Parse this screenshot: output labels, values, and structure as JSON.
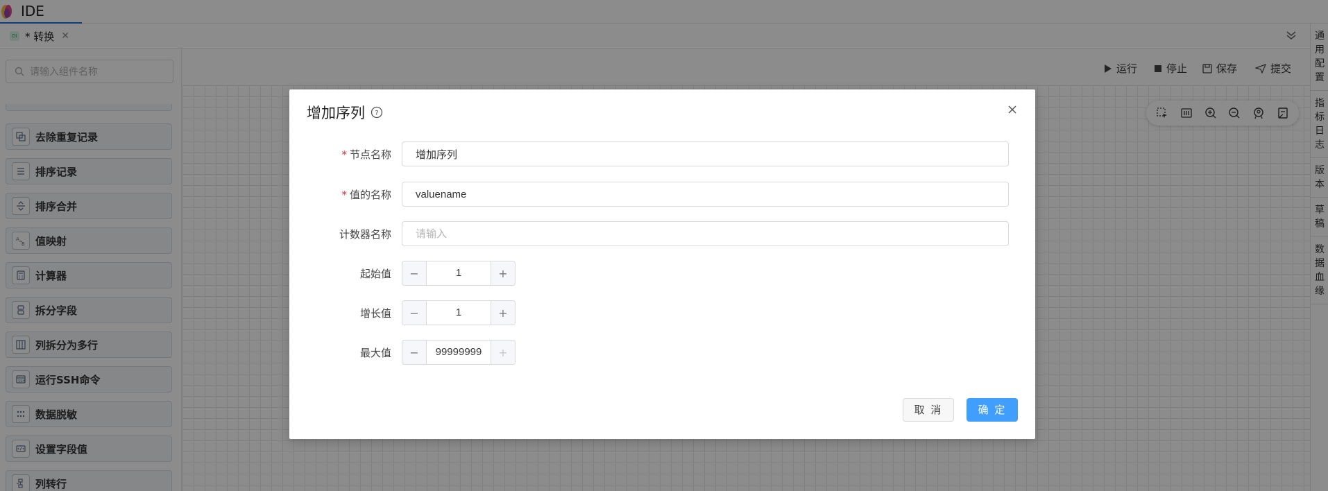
{
  "app": {
    "title": "IDE"
  },
  "tabs": [
    {
      "icon_text": "DI",
      "label": "* 转换"
    }
  ],
  "right_rail": [
    "通用配置",
    "指标日志",
    "版本",
    "草稿",
    "数据血缘"
  ],
  "sidebar": {
    "search_placeholder": "请输入组件名称",
    "items": [
      {
        "label": "去除重复记录",
        "icon": "dedupe-icon"
      },
      {
        "label": "排序记录",
        "icon": "sort-records-icon"
      },
      {
        "label": "排序合并",
        "icon": "sort-merge-icon"
      },
      {
        "label": "值映射",
        "icon": "value-mapper-icon"
      },
      {
        "label": "计算器",
        "icon": "calculator-icon"
      },
      {
        "label": "拆分字段",
        "icon": "split-field-icon"
      },
      {
        "label": "列拆分为多行",
        "icon": "split-to-rows-icon"
      },
      {
        "label": "运行SSH命令",
        "icon": "ssh-command-icon"
      },
      {
        "label": "数据脱敏",
        "icon": "data-masking-icon"
      },
      {
        "label": "设置字段值",
        "icon": "set-field-value-icon"
      },
      {
        "label": "列转行",
        "icon": "column-to-row-icon"
      }
    ]
  },
  "toolbar": {
    "run": "运行",
    "stop": "停止",
    "save": "保存",
    "submit": "提交"
  },
  "modal": {
    "title": "增加序列",
    "fields": {
      "node_name": {
        "label": "节点名称",
        "required": true,
        "value": "增加序列"
      },
      "value_name": {
        "label": "值的名称",
        "required": true,
        "value": "valuename"
      },
      "counter_name": {
        "label": "计数器名称",
        "required": false,
        "value": "",
        "placeholder": "请输入"
      },
      "start_value": {
        "label": "起始值",
        "value": "1"
      },
      "increment": {
        "label": "增长值",
        "value": "1"
      },
      "max_value": {
        "label": "最大值",
        "value": "99999999"
      }
    },
    "cancel_label": "取 消",
    "ok_label": "确 定"
  },
  "colors": {
    "primary": "#409eff",
    "required": "#e0303a",
    "overlay": "rgba(0,0,0,0.45)"
  }
}
